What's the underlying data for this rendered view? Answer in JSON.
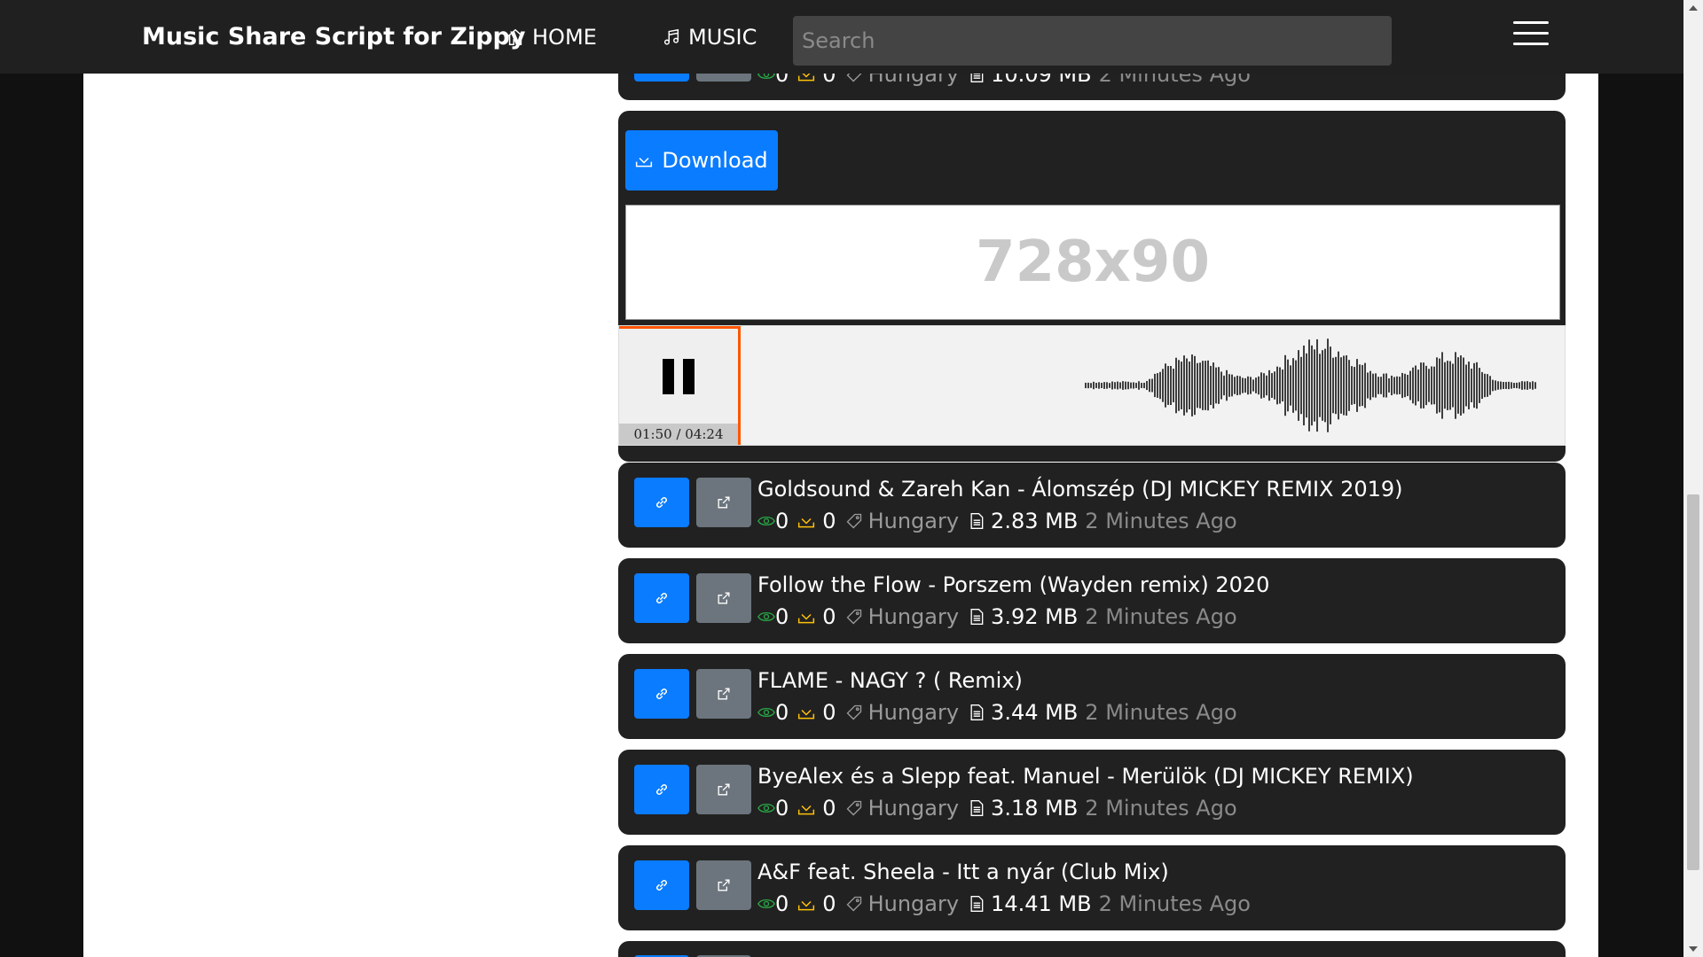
{
  "navbar": {
    "brand": "Music Share Script for Zippy",
    "home_label": "HOME",
    "music_label": "MUSIC",
    "search_placeholder": "Search"
  },
  "player_card": {
    "download_label": "Download",
    "ad_text": "728x90",
    "time": "01:50 / 04:24",
    "progress": 0.4167
  },
  "tracks": [
    {
      "title": "",
      "views": "0",
      "downloads": "0",
      "country": "Hungary",
      "size": "10.09 MB",
      "ago": "2 Minutes Ago"
    },
    {
      "title": "Goldsound & Zareh Kan - Álomszép (DJ MICKEY REMIX 2019)",
      "views": "0",
      "downloads": "0",
      "country": "Hungary",
      "size": "2.83 MB",
      "ago": "2 Minutes Ago"
    },
    {
      "title": "Follow the Flow - Porszem (Wayden remix) 2020",
      "views": "0",
      "downloads": "0",
      "country": "Hungary",
      "size": "3.92 MB",
      "ago": "2 Minutes Ago"
    },
    {
      "title": "FLAME - NAGY ? ( Remix)",
      "views": "0",
      "downloads": "0",
      "country": "Hungary",
      "size": "3.44 MB",
      "ago": "2 Minutes Ago"
    },
    {
      "title": "ByeAlex és a Slepp feat. Manuel - Merülök (DJ MICKEY REMIX)",
      "views": "0",
      "downloads": "0",
      "country": "Hungary",
      "size": "3.18 MB",
      "ago": "2 Minutes Ago"
    },
    {
      "title": "A&F feat. Sheela - Itt a nyár (Club Mix)",
      "views": "0",
      "downloads": "0",
      "country": "Hungary",
      "size": "14.41 MB",
      "ago": "2 Minutes Ago"
    }
  ],
  "icons": {
    "link": "link-icon",
    "share": "share-icon",
    "eye": "eye-icon",
    "download": "download-icon",
    "tag": "tag-icon",
    "file": "file-icon",
    "home": "home-icon",
    "music": "music-note-icon"
  },
  "colors": {
    "primary": "#0a7cff",
    "secondary": "#6c757d",
    "progress": "#ff5500",
    "eye": "#28a745",
    "download": "#ffc107"
  }
}
